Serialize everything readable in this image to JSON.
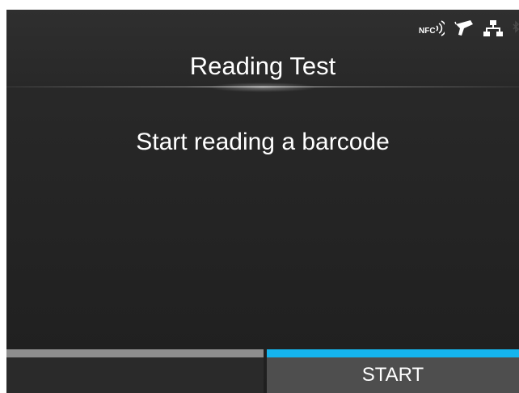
{
  "header": {
    "title": "Reading Test",
    "status_icons": {
      "nfc_label": "NFC",
      "icons": [
        "nfc-icon",
        "barcode-scanner-icon",
        "network-icon",
        "bluetooth-icon"
      ]
    }
  },
  "main": {
    "message": "Start reading a barcode"
  },
  "softkeys": {
    "left_label": "",
    "right_label": "START"
  },
  "colors": {
    "accent": "#14b4ee",
    "background": "#252525",
    "inactive_key_bar": "#8e8e8e"
  }
}
